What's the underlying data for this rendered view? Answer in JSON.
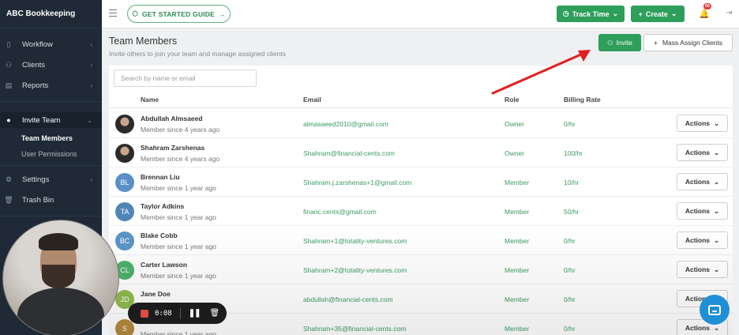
{
  "sidebar": {
    "brand": "ABC Bookkeeping",
    "items": [
      {
        "label": "Workflow",
        "icon": "clipboard-icon"
      },
      {
        "label": "Clients",
        "icon": "users-icon"
      },
      {
        "label": "Reports",
        "icon": "chart-icon"
      },
      {
        "label": "Invite Team",
        "icon": "team-icon"
      },
      {
        "label": "Settings",
        "icon": "gear-icon"
      },
      {
        "label": "Trash Bin",
        "icon": "trash-icon"
      }
    ],
    "sub_items": [
      "Team Members",
      "User Permissions"
    ]
  },
  "topbar": {
    "guide_label": "GET STARTED GUIDE",
    "track_time_label": "Track Time",
    "create_label": "Create",
    "notification_count": "66"
  },
  "page": {
    "title": "Team Members",
    "subtitle": "Invite others to join your team and manage assigned clients",
    "invite_label": "Invite",
    "mass_assign_label": "Mass Assign Clients",
    "search_placeholder": "Search by name or email"
  },
  "table": {
    "headers": {
      "name": "Name",
      "email": "Email",
      "role": "Role",
      "billing": "Billing Rate"
    },
    "actions_label": "Actions",
    "rows": [
      {
        "initials": "",
        "name": "Abdullah Almsaeed",
        "since": "Member since 4 years ago",
        "email": "almasaeed2010@gmail.com",
        "role": "Owner",
        "rate": "0/hr",
        "color": "#444444"
      },
      {
        "initials": "",
        "name": "Shahram Zarshenas",
        "since": "Member since 4 years ago",
        "email": "Shahram@financial-cents.com",
        "role": "Owner",
        "rate": "100/hr",
        "color": "#444444"
      },
      {
        "initials": "BL",
        "name": "Brennan Liu",
        "since": "Member since 1 year ago",
        "email": "Shahram.j.zarshenas+1@gmail.com",
        "role": "Member",
        "rate": "10/hr",
        "color": "#5b8fc7"
      },
      {
        "initials": "TA",
        "name": "Taylor Adkins",
        "since": "Member since 1 year ago",
        "email": "financ.cents@gmail.com",
        "role": "Member",
        "rate": "50/hr",
        "color": "#4f86b8"
      },
      {
        "initials": "BC",
        "name": "Blake Cobb",
        "since": "Member since 1 year ago",
        "email": "Shahram+1@totality-ventures.com",
        "role": "Member",
        "rate": "0/hr",
        "color": "#5a95c4"
      },
      {
        "initials": "CL",
        "name": "Carter Lawson",
        "since": "Member since 1 year ago",
        "email": "Shahram+2@totality-ventures.com",
        "role": "Member",
        "rate": "0/hr",
        "color": "#4caf6a"
      },
      {
        "initials": "JD",
        "name": "Jane Doe",
        "since": "",
        "email": "abdullah@financial-cents.com",
        "role": "Member",
        "rate": "0/hr",
        "color": "#8fba4d"
      },
      {
        "initials": "S",
        "name": "",
        "since": "Member since 1 year ago",
        "email": "Shahram+35@financial-cents.com",
        "role": "Member",
        "rate": "0/hr",
        "color": "#b58a3c"
      }
    ]
  },
  "recorder": {
    "time": "0:08"
  },
  "colors": {
    "accent": "#2e9e5b",
    "sidebar": "#1f2a36",
    "link": "#3c9a64",
    "arrow": "#e02020"
  }
}
